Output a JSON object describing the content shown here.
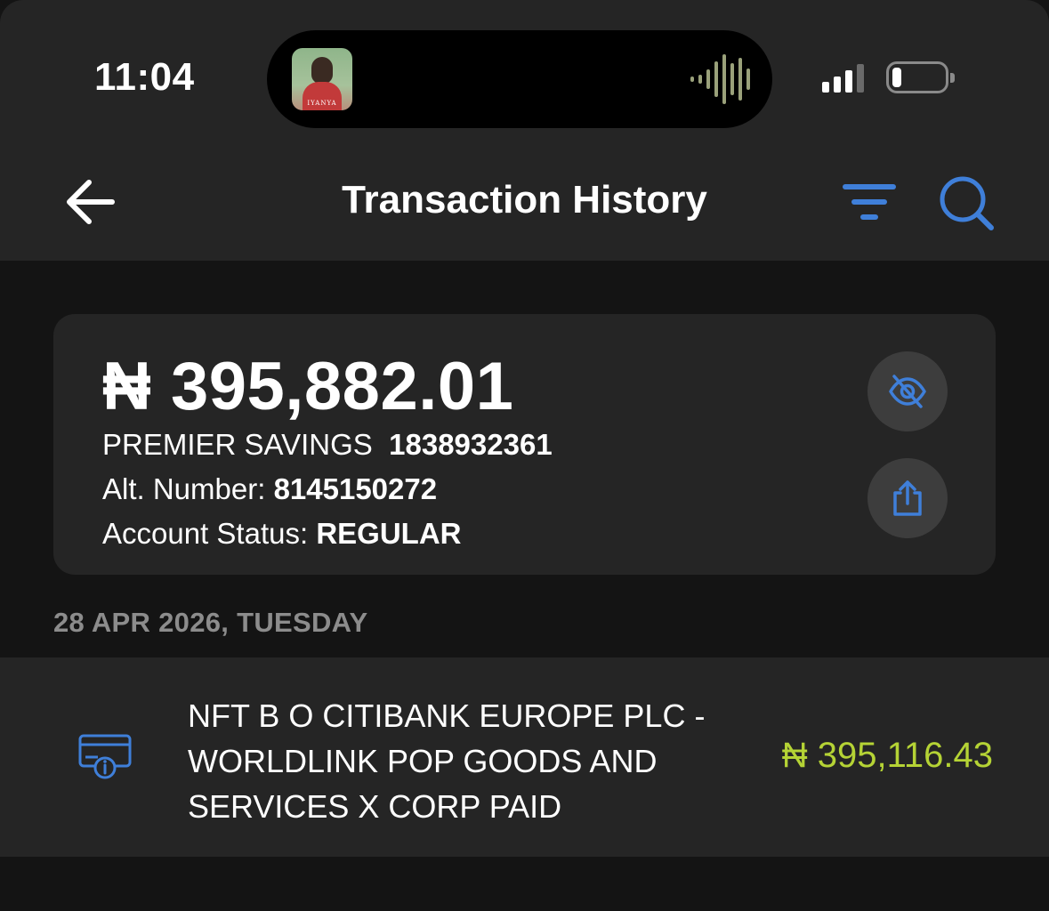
{
  "status_bar": {
    "time": "11:04",
    "now_playing_art_text": "IYANYA",
    "signal_icon": "cellular-signal-icon",
    "battery_icon": "battery-low-icon",
    "waveform_icon": "audio-waveform-icon"
  },
  "header": {
    "title": "Transaction History",
    "back_icon": "arrow-left-icon",
    "filter_icon": "filter-icon",
    "search_icon": "search-icon"
  },
  "account": {
    "balance": "₦ 395,882.01",
    "account_type": "PREMIER SAVINGS",
    "account_number": "1838932361",
    "alt_label": "Alt. Number:",
    "alt_number": "8145150272",
    "status_label": "Account Status:",
    "status_value": "REGULAR",
    "hide_icon": "eye-slash-icon",
    "share_icon": "share-icon"
  },
  "transactions": [
    {
      "date": "28 APR 2026, TUESDAY",
      "icon": "card-info-icon",
      "description": "NFT B O CITIBANK EUROPE PLC - WORLDLINK POP GOODS AND SERVICES X CORP PAID",
      "amount": "₦ 395,116.43"
    }
  ],
  "colors": {
    "background": "#141414",
    "surface": "#252525",
    "accent_blue": "#3f7fd9",
    "credit_green": "#b5d335",
    "muted_text": "#8c8c8c"
  }
}
